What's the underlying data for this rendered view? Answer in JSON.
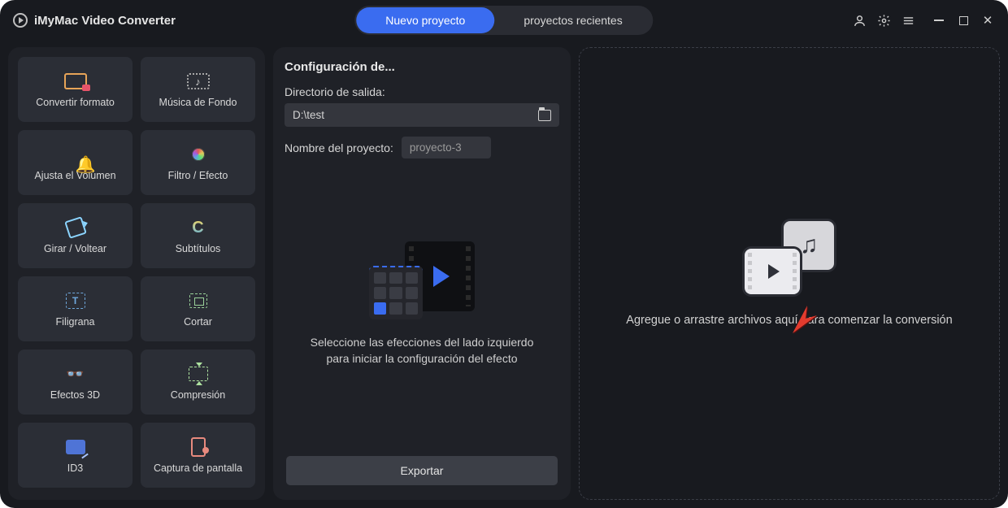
{
  "app": {
    "title": "iMyMac Video Converter"
  },
  "tabs": {
    "new_project": "Nuevo proyecto",
    "recent_projects": "proyectos recientes"
  },
  "sidebar": {
    "tools": [
      {
        "id": "convert-format",
        "label": "Convertir formato"
      },
      {
        "id": "background-music",
        "label": "Música de Fondo"
      },
      {
        "id": "adjust-volume",
        "label": "Ajusta el Volúmen"
      },
      {
        "id": "filter-effect",
        "label": "Filtro / Efecto"
      },
      {
        "id": "rotate-flip",
        "label": "Girar / Voltear"
      },
      {
        "id": "subtitles",
        "label": "Subtítulos"
      },
      {
        "id": "watermark",
        "label": "Filigrana"
      },
      {
        "id": "crop",
        "label": "Cortar"
      },
      {
        "id": "effects-3d",
        "label": "Efectos 3D"
      },
      {
        "id": "compression",
        "label": "Compresión"
      },
      {
        "id": "id3",
        "label": "ID3"
      },
      {
        "id": "screenshot",
        "label": "Captura de pantalla"
      }
    ]
  },
  "config": {
    "title": "Configuración de...",
    "output_dir_label": "Directorio de salida:",
    "output_dir_value": "D:\\test",
    "project_name_label": "Nombre del proyecto:",
    "project_name_value": "proyecto-3",
    "hint_line1": "Seleccione las efecciones del lado izquierdo",
    "hint_line2": "para iniciar la configuración del efecto",
    "export_label": "Exportar"
  },
  "dropzone": {
    "text": "Agregue o arrastre archivos aquí para comenzar la conversión"
  }
}
